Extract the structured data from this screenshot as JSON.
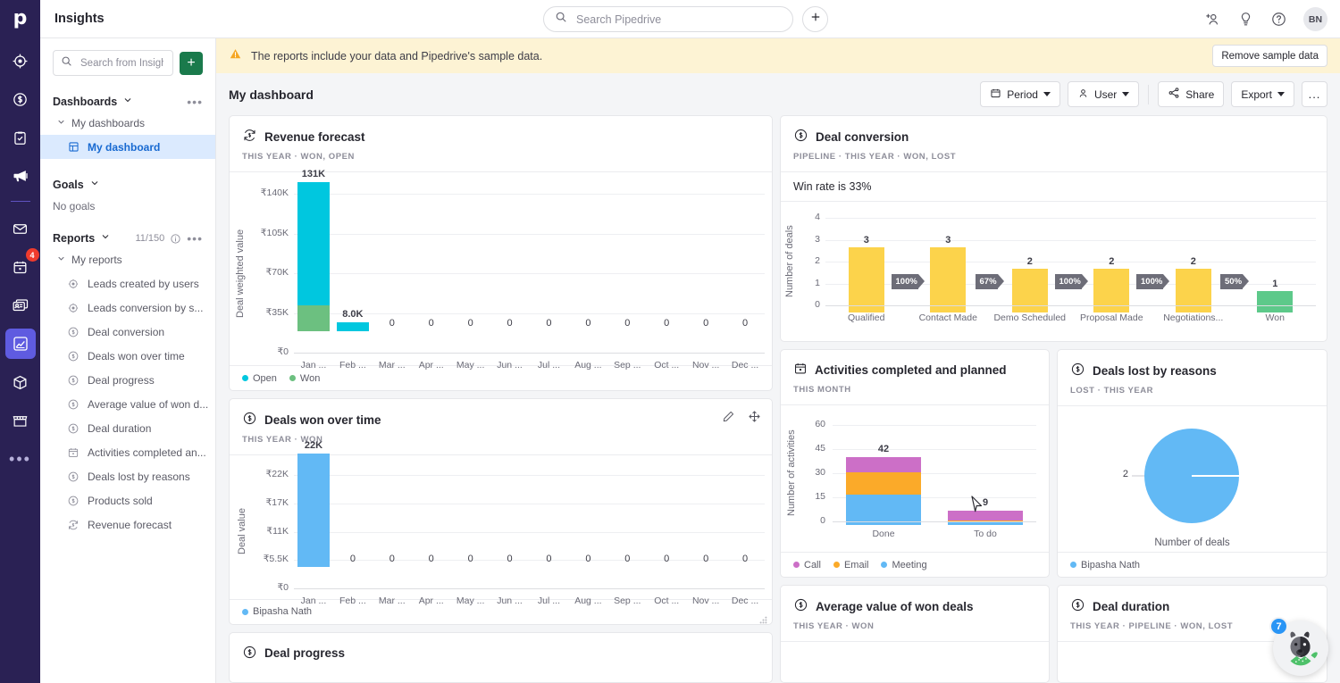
{
  "brand": {
    "logo_letter": "p",
    "rail_bg": "#2a2154",
    "accent": "#5f5be0"
  },
  "rail": {
    "items": [
      {
        "name": "leads",
        "icon": "target-icon"
      },
      {
        "name": "deals",
        "icon": "dollar-circle-icon"
      },
      {
        "name": "activities",
        "icon": "clipboard-check-icon"
      },
      {
        "name": "campaigns",
        "icon": "megaphone-icon"
      },
      {
        "name": "mail",
        "icon": "envelope-icon"
      },
      {
        "name": "calendar",
        "icon": "calendar-icon",
        "badge": "4"
      },
      {
        "name": "contacts",
        "icon": "contact-cards-icon"
      },
      {
        "name": "insights",
        "icon": "chart-icon",
        "active": true
      },
      {
        "name": "products",
        "icon": "box-icon"
      },
      {
        "name": "marketplace",
        "icon": "store-icon"
      },
      {
        "name": "more",
        "icon": "ellipsis-icon"
      }
    ]
  },
  "topbar": {
    "title": "Insights",
    "search": {
      "placeholder": "Search Pipedrive",
      "value": ""
    },
    "add_label": "+",
    "icons": [
      "add-person-icon",
      "lightbulb-icon",
      "help-icon"
    ],
    "avatar_initials": "BN"
  },
  "sidebar": {
    "search": {
      "placeholder": "Search from Insights",
      "value": ""
    },
    "add_label": "+",
    "dashboards": {
      "label": "Dashboards",
      "group_label": "My dashboards",
      "items": [
        {
          "label": "My dashboard",
          "icon": "dashboard-grid-icon",
          "selected": true
        }
      ]
    },
    "goals": {
      "label": "Goals",
      "empty_text": "No goals"
    },
    "reports": {
      "label": "Reports",
      "count": "11/150",
      "group_label": "My reports",
      "items": [
        {
          "label": "Leads created by users",
          "icon": "target-icon"
        },
        {
          "label": "Leads conversion by s...",
          "icon": "target-icon"
        },
        {
          "label": "Deal conversion",
          "icon": "dollar-circle-icon"
        },
        {
          "label": "Deals won over time",
          "icon": "dollar-circle-icon"
        },
        {
          "label": "Deal progress",
          "icon": "dollar-circle-icon"
        },
        {
          "label": "Average value of won d...",
          "icon": "dollar-circle-icon"
        },
        {
          "label": "Deal duration",
          "icon": "dollar-circle-icon"
        },
        {
          "label": "Activities completed an...",
          "icon": "calendar-icon"
        },
        {
          "label": "Deals lost by reasons",
          "icon": "dollar-circle-icon"
        },
        {
          "label": "Products sold",
          "icon": "dollar-circle-icon"
        },
        {
          "label": "Revenue forecast",
          "icon": "revenue-forecast-icon"
        }
      ]
    }
  },
  "banner": {
    "icon": "warning-icon",
    "text": "The reports include your data and Pipedrive's sample data.",
    "action_label": "Remove sample data",
    "bg": "#fdf3d4"
  },
  "dashboard_bar": {
    "title": "My dashboard",
    "period_label": "Period",
    "user_label": "User",
    "share_label": "Share",
    "export_label": "Export",
    "more_label": "..."
  },
  "cards": {
    "revenue_forecast": {
      "title": "Revenue forecast",
      "icon": "revenue-forecast-icon",
      "meta": "THIS YEAR  ·  WON, OPEN"
    },
    "deal_conversion": {
      "title": "Deal conversion",
      "icon": "dollar-circle-icon",
      "meta": "PIPELINE  ·  THIS YEAR  ·  WON, LOST",
      "win_rate_text": "Win rate is 33%"
    },
    "deals_won_over_time": {
      "title": "Deals won over time",
      "icon": "dollar-circle-icon",
      "meta": "THIS YEAR  ·  WON",
      "tools": [
        "edit-icon",
        "move-icon"
      ]
    },
    "activities": {
      "title": "Activities completed and planned",
      "icon": "calendar-icon",
      "meta": "THIS MONTH"
    },
    "deals_lost": {
      "title": "Deals lost by reasons",
      "icon": "dollar-circle-icon",
      "meta": "LOST  ·  THIS YEAR"
    },
    "avg_value": {
      "title": "Average value of won deals",
      "icon": "dollar-circle-icon",
      "meta": "THIS YEAR  ·  WON"
    },
    "deal_duration": {
      "title": "Deal duration",
      "icon": "dollar-circle-icon",
      "meta": "THIS YEAR  ·  PIPELINE  ·  WON, LOST"
    },
    "deal_progress": {
      "title": "Deal progress",
      "icon": "dollar-circle-icon"
    }
  },
  "mascot": {
    "badge": "7",
    "name": "pipedrive-assistant"
  },
  "chart_data": [
    {
      "id": "revenue_forecast",
      "type": "bar",
      "title": "Revenue forecast",
      "stacked": true,
      "xlabel": "",
      "ylabel": "Deal weighted value",
      "categories": [
        "Jan ...",
        "Feb ...",
        "Mar ...",
        "Apr ...",
        "May ...",
        "Jun ...",
        "Jul ...",
        "Aug ...",
        "Sep ...",
        "Oct ...",
        "Nov ...",
        "Dec ..."
      ],
      "yticks": [
        "₹0",
        "₹35K",
        "₹70K",
        "₹105K",
        "₹140K"
      ],
      "ylim": [
        0,
        140000
      ],
      "series": [
        {
          "name": "Open",
          "color": "#00c7df",
          "values": [
            108000,
            8000,
            0,
            0,
            0,
            0,
            0,
            0,
            0,
            0,
            0,
            0
          ]
        },
        {
          "name": "Won",
          "color": "#6cc080",
          "values": [
            23000,
            0,
            0,
            0,
            0,
            0,
            0,
            0,
            0,
            0,
            0,
            0
          ]
        }
      ],
      "total_labels": [
        "131K",
        "8.0K",
        "0",
        "0",
        "0",
        "0",
        "0",
        "0",
        "0",
        "0",
        "0",
        "0"
      ],
      "legend": [
        {
          "label": "Open",
          "color": "#00c7df"
        },
        {
          "label": "Won",
          "color": "#6cc080"
        }
      ],
      "legend_position": "bottom"
    },
    {
      "id": "deal_conversion",
      "type": "bar",
      "title": "Deal conversion",
      "xlabel": "",
      "ylabel": "Number of deals",
      "categories": [
        "Qualified",
        "Contact Made",
        "Demo Scheduled",
        "Proposal Made",
        "Negotiations...",
        "Won"
      ],
      "values": [
        3,
        3,
        2,
        2,
        2,
        1
      ],
      "value_labels": [
        "3",
        "3",
        "2",
        "2",
        "2",
        "1"
      ],
      "bar_colors": [
        "#fcd34b",
        "#fcd34b",
        "#fcd34b",
        "#fcd34b",
        "#fcd34b",
        "#5dc98a"
      ],
      "yticks": [
        "0",
        "1",
        "2",
        "3",
        "4"
      ],
      "ylim": [
        0,
        4
      ],
      "conversion_labels": [
        "100%",
        "67%",
        "100%",
        "100%",
        "50%"
      ]
    },
    {
      "id": "deals_won_over_time",
      "type": "bar",
      "title": "Deals won over time",
      "xlabel": "",
      "ylabel": "Deal value",
      "categories": [
        "Jan ...",
        "Feb ...",
        "Mar ...",
        "Apr ...",
        "May ...",
        "Jun ...",
        "Jul ...",
        "Aug ...",
        "Sep ...",
        "Oct ...",
        "Nov ...",
        "Dec ..."
      ],
      "series": [
        {
          "name": "Bipasha Nath",
          "color": "#62b9f5",
          "values": [
            22000,
            0,
            0,
            0,
            0,
            0,
            0,
            0,
            0,
            0,
            0,
            0
          ]
        }
      ],
      "value_labels": [
        "22K",
        "0",
        "0",
        "0",
        "0",
        "0",
        "0",
        "0",
        "0",
        "0",
        "0",
        "0"
      ],
      "yticks": [
        "₹0",
        "₹5.5K",
        "₹11K",
        "₹17K",
        "₹22K"
      ],
      "ylim": [
        0,
        22000
      ],
      "legend": [
        {
          "label": "Bipasha Nath",
          "color": "#62b9f5"
        }
      ],
      "legend_position": "bottom"
    },
    {
      "id": "activities",
      "type": "bar",
      "title": "Activities completed and planned",
      "stacked": true,
      "xlabel": "",
      "ylabel": "Number of activities",
      "categories": [
        "Done",
        "To do"
      ],
      "yticks": [
        "0",
        "15",
        "30",
        "45",
        "60"
      ],
      "ylim": [
        0,
        60
      ],
      "series": [
        {
          "name": "Meeting",
          "color": "#62b9f5",
          "values": [
            19,
            2
          ]
        },
        {
          "name": "Email",
          "color": "#fbaa29",
          "values": [
            14,
            1
          ]
        },
        {
          "name": "Call",
          "color": "#c濫",
          "values": [
            9,
            6
          ]
        }
      ],
      "total_labels": [
        "42",
        "9"
      ],
      "legend": [
        {
          "label": "Call",
          "color": "#cc6fc7"
        },
        {
          "label": "Email",
          "color": "#fbaa29"
        },
        {
          "label": "Meeting",
          "color": "#62b9f5"
        }
      ],
      "legend_position": "bottom"
    },
    {
      "id": "deals_lost",
      "type": "pie",
      "title": "Deals lost by reasons",
      "caption": "Number of deals",
      "slices": [
        {
          "label": "Bipasha Nath",
          "value": 2,
          "value_label": "2",
          "color": "#62b9f5"
        }
      ],
      "legend": [
        {
          "label": "Bipasha Nath",
          "color": "#62b9f5"
        }
      ],
      "legend_position": "bottom"
    }
  ]
}
